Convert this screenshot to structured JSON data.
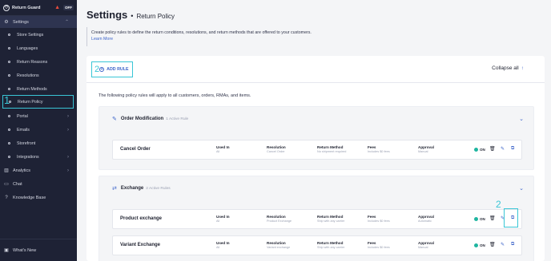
{
  "sidebar": {
    "brand": "Return Guard",
    "brand_status": "OFF",
    "items": [
      {
        "label": "Settings",
        "icon": "gear-icon"
      },
      {
        "label": "Store Settings"
      },
      {
        "label": "Languages"
      },
      {
        "label": "Return Reasons"
      },
      {
        "label": "Resolutions"
      },
      {
        "label": "Return Methods"
      },
      {
        "label": "Return Policy"
      },
      {
        "label": "Portal"
      },
      {
        "label": "Emails"
      },
      {
        "label": "Storefront"
      },
      {
        "label": "Integrations"
      },
      {
        "label": "Analytics",
        "icon": "chart-icon"
      },
      {
        "label": "Chat",
        "icon": "chat-icon"
      },
      {
        "label": "Knowledge Base",
        "icon": "help-icon"
      }
    ],
    "whats_new": "What's New",
    "annotation": "1"
  },
  "header": {
    "title": "Settings",
    "separator": "•",
    "subtitle": "Return Policy"
  },
  "info": {
    "text": "Create policy rules to define the return conditions, resolutions, and return methods that are offered to your customers.",
    "link": "Learn More"
  },
  "toolbar": {
    "annotation": "2",
    "add_rule": "ADD RULE",
    "collapse_all": "Collapse all"
  },
  "intro": "The following policy rules will apply to all customers, orders, RMAs, and items.",
  "groups": [
    {
      "name": "Order Modification",
      "count": "1 Active Rule",
      "rules": [
        {
          "name": "Cancel Order",
          "used_in_label": "Used In",
          "used_in": "All",
          "resolution_label": "Resolution",
          "resolution": "Cancel Order",
          "method_label": "Return Method",
          "method": "No shipment required",
          "fees_label": "Fees",
          "fees": "Includes $0 fees",
          "approval_label": "Approval",
          "approval": "Manual",
          "status": "ON"
        }
      ]
    },
    {
      "name": "Exchange",
      "count": "2 Active Rules",
      "rules": [
        {
          "name": "Product exchange",
          "used_in_label": "Used In",
          "used_in": "All",
          "resolution_label": "Resolution",
          "resolution": "Product Exchange",
          "method_label": "Return Method",
          "method": "Ship with any carrier",
          "fees_label": "Fees",
          "fees": "Includes $0 fees",
          "approval_label": "Approval",
          "approval": "Automatic",
          "status": "ON",
          "annotation": "2"
        },
        {
          "name": "Variant Exchange",
          "used_in_label": "Used In",
          "used_in": "All",
          "resolution_label": "Resolution",
          "resolution": "Variant exchange",
          "method_label": "Return Method",
          "method": "Ship with any carrier",
          "fees_label": "Fees",
          "fees": "Includes $0 fees",
          "approval_label": "Approval",
          "approval": "Manual",
          "status": "ON"
        }
      ]
    }
  ],
  "colors": {
    "sidebar_bg": "#1e2235",
    "accent": "#3b63c9",
    "highlight": "#39c6d6",
    "status_on": "#1fb5a0"
  }
}
